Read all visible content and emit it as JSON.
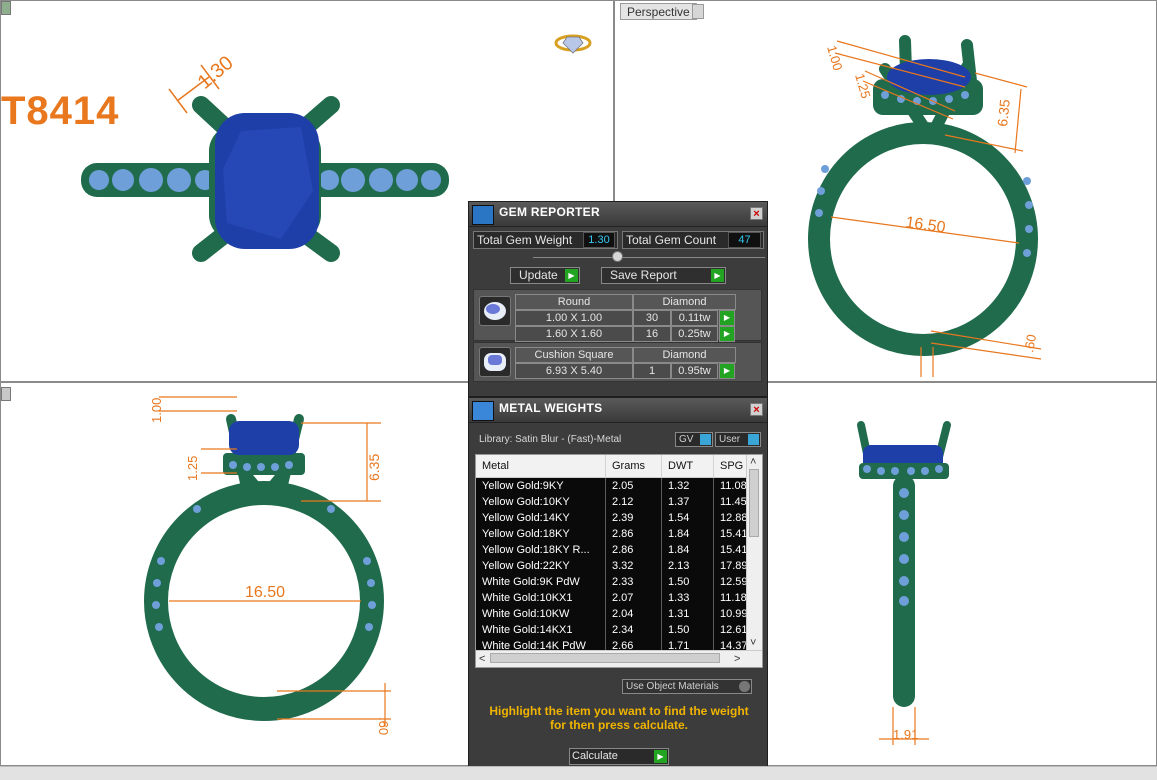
{
  "viewports": {
    "top_left": {
      "sku": "T8414",
      "dims": [
        "1.30"
      ]
    },
    "top_right": {
      "tab_label": "Perspective",
      "dims": [
        "1.00",
        "1.25",
        "6.35",
        "16.50",
        ".60"
      ]
    },
    "bottom_left": {
      "dims": [
        "1.00",
        "1.25",
        "6.35",
        "16.50",
        ".60"
      ]
    },
    "bottom_right": {
      "dims": [
        "1.91"
      ]
    }
  },
  "gem_reporter": {
    "title": "GEM REPORTER",
    "total_weight_label": "Total Gem Weight",
    "total_weight_value": "1.30",
    "total_count_label": "Total Gem Count",
    "total_count_value": "47",
    "update_label": "Update",
    "save_label": "Save Report",
    "groups": [
      {
        "shape": "Round",
        "material": "Diamond",
        "rows": [
          {
            "size": "1.00 X 1.00",
            "count": "30",
            "weight": "0.11tw"
          },
          {
            "size": "1.60 X 1.60",
            "count": "16",
            "weight": "0.25tw"
          }
        ]
      },
      {
        "shape": "Cushion Square",
        "material": "Diamond",
        "rows": [
          {
            "size": "6.93 X 5.40",
            "count": "1",
            "weight": "0.95tw"
          }
        ]
      }
    ]
  },
  "metal_weights": {
    "title": "METAL WEIGHTS",
    "library": "Library: Satin Blur - (Fast)-Metal",
    "toggle_gv": "GV",
    "toggle_user": "User",
    "columns": [
      "Metal",
      "Grams",
      "DWT",
      "SPG"
    ],
    "rows": [
      [
        "Yellow Gold:9KY",
        "2.05",
        "1.32",
        "11.08"
      ],
      [
        "Yellow Gold:10KY",
        "2.12",
        "1.37",
        "11.45"
      ],
      [
        "Yellow Gold:14KY",
        "2.39",
        "1.54",
        "12.88"
      ],
      [
        "Yellow Gold:18KY",
        "2.86",
        "1.84",
        "15.41"
      ],
      [
        "Yellow Gold:18KY R...",
        "2.86",
        "1.84",
        "15.41"
      ],
      [
        "Yellow Gold:22KY",
        "3.32",
        "2.13",
        "17.89"
      ],
      [
        "White Gold:9K PdW",
        "2.33",
        "1.50",
        "12.59"
      ],
      [
        "White Gold:10KX1",
        "2.07",
        "1.33",
        "11.18"
      ],
      [
        "White Gold:10KW",
        "2.04",
        "1.31",
        "10.99"
      ],
      [
        "White Gold:14KX1",
        "2.34",
        "1.50",
        "12.61"
      ],
      [
        "White Gold:14K PdW",
        "2.66",
        "1.71",
        "14.37"
      ]
    ],
    "use_object_materials": "Use Object Materials",
    "hint": "Highlight the item you want to find the weight for then press calculate.",
    "calculate_label": "Calculate"
  },
  "colors": {
    "metal": "#1f6b4c",
    "gem": "#1e3fa8",
    "accent_stones": "#6f9fd8",
    "dimension": "#e8771e",
    "panel_bg": "#3c3c3c",
    "value_text": "#35c8f0",
    "hint_text": "#f0b400"
  }
}
